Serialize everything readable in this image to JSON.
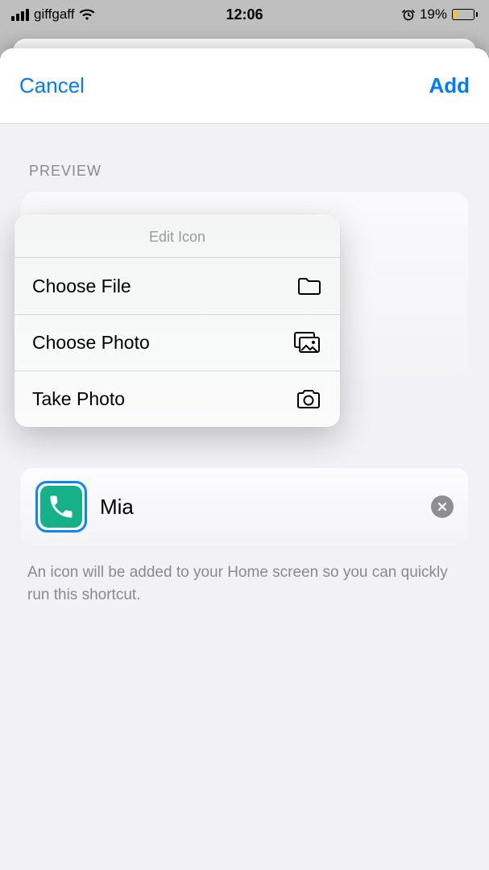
{
  "status": {
    "carrier": "giffgaff",
    "time": "12:06",
    "battery_text": "19%"
  },
  "header": {
    "cancel_label": "Cancel",
    "add_label": "Add"
  },
  "preview": {
    "section_label": "PREVIEW"
  },
  "shortcut": {
    "name": "Mia",
    "icon_color": "#15b28a"
  },
  "footer": {
    "note": "An icon will be added to your Home screen so you can quickly run this shortcut."
  },
  "menu": {
    "title": "Edit Icon",
    "items": [
      {
        "label": "Choose File",
        "icon": "folder-icon"
      },
      {
        "label": "Choose Photo",
        "icon": "gallery-icon"
      },
      {
        "label": "Take Photo",
        "icon": "camera-icon"
      }
    ]
  }
}
